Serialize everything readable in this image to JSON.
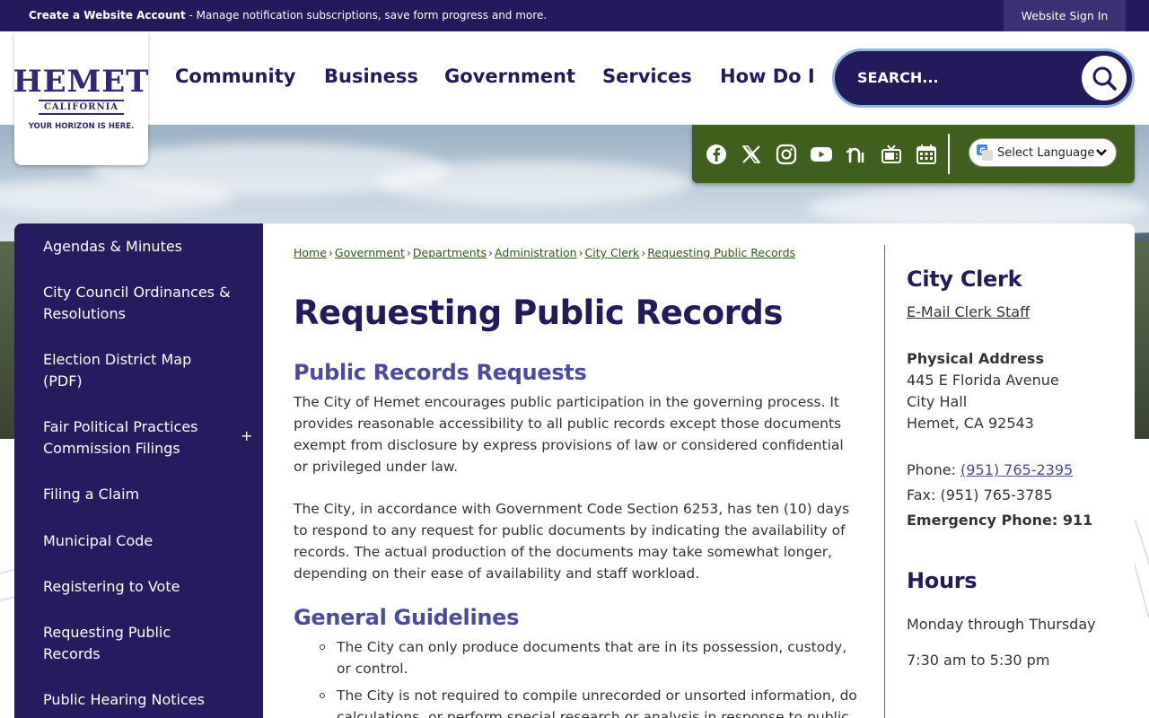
{
  "topbar": {
    "create_strong": "Create a Website Account",
    "create_rest": " - Manage notification subscriptions, save form progress and more.",
    "sign_in": "Website Sign In"
  },
  "logo": {
    "word": "HEMET",
    "sub": "CALIFORNIA",
    "tagline": "YOUR HORIZON IS HERE.",
    "colors": {
      "navy": "#2d2a7a",
      "orange": "#f5a623"
    }
  },
  "nav": {
    "items": [
      "Community",
      "Business",
      "Government",
      "Services",
      "How Do I"
    ]
  },
  "search": {
    "placeholder": "SEARCH..."
  },
  "social": {
    "icons": [
      "facebook-icon",
      "x-twitter-icon",
      "instagram-icon",
      "youtube-icon",
      "nextdoor-icon",
      "tv-icon",
      "calendar-icon"
    ],
    "language_label": "Select Language"
  },
  "sidebar": {
    "items": [
      "Agendas & Minutes",
      "City Council Ordinances & Resolutions",
      "Election District Map (PDF)",
      "Fair Political Practices Commission Filings",
      "Filing a Claim",
      "Municipal Code",
      "Registering to Vote",
      "Requesting Public Records",
      "Public Hearing Notices"
    ],
    "expand_symbol": "+"
  },
  "breadcrumb": [
    "Home",
    "Government",
    "Departments",
    "Administration",
    "City Clerk",
    "Requesting Public Records"
  ],
  "breadcrumb_sep": "›",
  "main": {
    "title": "Requesting Public Records",
    "section1_heading": "Public Records Requests",
    "para1": "The City of Hemet encourages public participation in the governing process. It provides reasonable accessibility to all public records except those documents exempt from disclosure by express provisions of law or considered confidential or privileged under law.",
    "para2": "The City, in accordance with Government Code Section 6253, has ten (10) days to respond to any request for public documents by indicating the availability of records. The actual production of the documents may take somewhat longer, depending on their ease of availability and staff workload.",
    "section2_heading": "General Guidelines",
    "bullets": [
      "The City can only produce documents that are in its possession, custody, or control.",
      "The City is not required to compile unrecorded or unsorted information, do calculations, or perform special research or analysis in response to public"
    ]
  },
  "aside": {
    "heading": "City Clerk",
    "email_link": "E-Mail Clerk Staff",
    "address_label": "Physical Address",
    "address_lines": [
      "445 E Florida Avenue",
      "City Hall",
      "Hemet, CA 92543"
    ],
    "phone_label": "Phone: ",
    "phone": "(951) 765-2395",
    "fax": "Fax: (951) 765-3785",
    "emergency": "Emergency Phone: 911",
    "hours_heading": "Hours",
    "hours_days": "Monday through Thursday",
    "hours_time": "7:30 am to 5:30 pm"
  },
  "colors": {
    "topbar": "#231a5c",
    "sidebar": "#251c60",
    "social_bar": "#3f5f1c",
    "heading": "#231a5c",
    "subheading": "#4a4aa0",
    "link_green": "#2b5a12",
    "divider": "#1f8a8a"
  }
}
